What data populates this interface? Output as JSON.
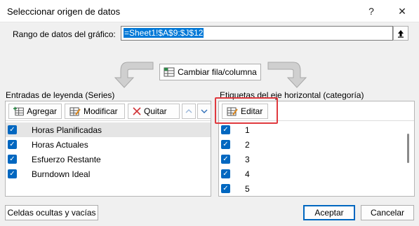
{
  "dialog": {
    "title": "Seleccionar origen de datos",
    "help_glyph": "?",
    "close_glyph": "✕"
  },
  "range": {
    "label": "Rango de datos del gráfico:",
    "value": "=Sheet1!$A$9:$J$12"
  },
  "switch_button": {
    "label": "Cambiar fila/columna"
  },
  "legend": {
    "heading": "Entradas de leyenda (Series)",
    "add_label": "Agregar",
    "edit_label": "Modificar",
    "remove_label": "Quitar",
    "series": [
      {
        "label": "Horas Planificadas",
        "checked": true,
        "selected": true
      },
      {
        "label": "Horas Actuales",
        "checked": true,
        "selected": false
      },
      {
        "label": "Esfuerzo Restante",
        "checked": true,
        "selected": false
      },
      {
        "label": "Burndown Ideal",
        "checked": true,
        "selected": false
      }
    ]
  },
  "axis": {
    "heading": "Etiquetas del eje horizontal (categoría)",
    "edit_label": "Editar",
    "categories": [
      "1",
      "2",
      "3",
      "4",
      "5"
    ]
  },
  "footer": {
    "hidden_cells_label": "Celdas ocultas y vacías",
    "ok_label": "Aceptar",
    "cancel_label": "Cancelar"
  },
  "icons": {
    "help": "help-icon",
    "close": "close-icon",
    "collapse": "collapse-dialog-icon",
    "switch": "switch-row-column-icon",
    "add": "add-series-icon",
    "edit": "edit-series-icon",
    "remove": "remove-icon",
    "up": "move-up-icon",
    "down": "move-down-icon",
    "axis_edit": "edit-axis-icon"
  },
  "colors": {
    "accent": "#0067c0",
    "highlight": "#e0393e",
    "remove": "#d13438"
  }
}
